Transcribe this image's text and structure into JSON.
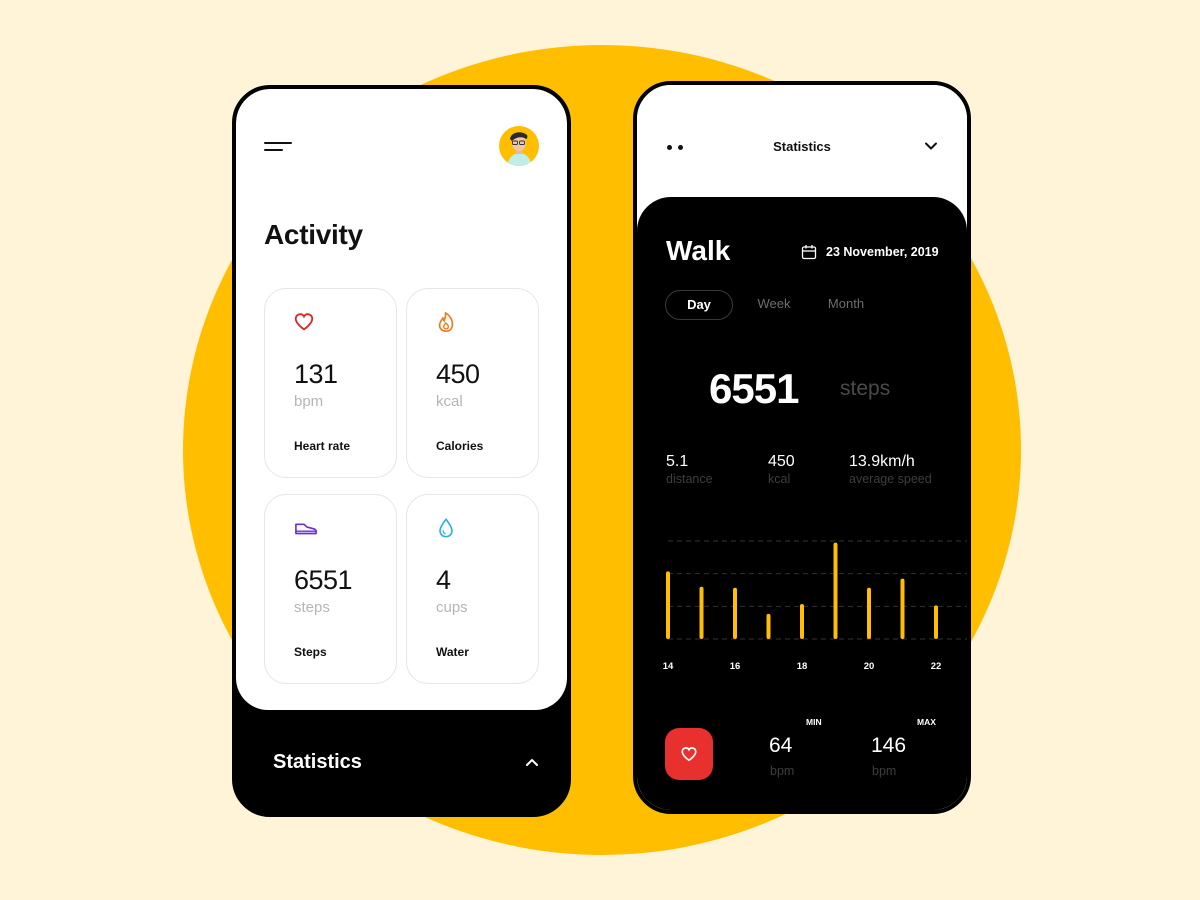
{
  "colors": {
    "background": "#fff4d8",
    "accent_yellow": "#ffbe00",
    "heart_red": "#e8302e",
    "calorie_orange": "#f07a1a",
    "steps_purple": "#6a2fd8",
    "water_blue": "#2ab0e0"
  },
  "activity_screen": {
    "menu_icon": "hamburger-menu-icon",
    "avatar": "user-avatar",
    "title": "Activity",
    "cards": [
      {
        "icon": "heart-icon",
        "value": "131",
        "unit": "bpm",
        "label": "Heart rate"
      },
      {
        "icon": "flame-icon",
        "value": "450",
        "unit": "kcal",
        "label": "Calories"
      },
      {
        "icon": "shoe-icon",
        "value": "6551",
        "unit": "steps",
        "label": "Steps"
      },
      {
        "icon": "water-drop-icon",
        "value": "4",
        "unit": "cups",
        "label": "Water"
      }
    ],
    "bottom_sheet": {
      "label": "Statistics",
      "icon": "chevron-up-icon"
    }
  },
  "statistics_screen": {
    "header": {
      "menu_icon": "dots-icon",
      "title": "Statistics",
      "collapse_icon": "chevron-down-icon"
    },
    "activity_title": "Walk",
    "date_icon": "calendar-icon",
    "date": "23 November, 2019",
    "tabs": [
      {
        "label": "Day",
        "active": true
      },
      {
        "label": "Week",
        "active": false
      },
      {
        "label": "Month",
        "active": false
      }
    ],
    "steps_value": "6551",
    "steps_unit": "steps",
    "metrics": [
      {
        "value": "5.1",
        "label": "distance"
      },
      {
        "value": "450",
        "label": "kcal"
      },
      {
        "value": "13.9km/h",
        "label": "average speed"
      }
    ],
    "heart_rate": {
      "icon": "heart-icon",
      "min_caption": "MIN",
      "min_value": "64",
      "min_unit": "bpm",
      "max_caption": "MAX",
      "max_value": "146",
      "max_unit": "bpm"
    }
  },
  "chart_data": {
    "type": "bar",
    "title": "",
    "xlabel": "",
    "ylabel": "",
    "x": [
      14,
      15,
      16,
      17,
      18,
      19,
      20,
      21,
      22
    ],
    "tick_labels": [
      "14",
      "16",
      "18",
      "20",
      "22"
    ],
    "tick_positions": [
      14,
      16,
      18,
      20,
      22
    ],
    "values": [
      2.07,
      1.6,
      1.57,
      0.77,
      1.07,
      2.95,
      1.57,
      1.85,
      1.03
    ],
    "ylim": [
      0,
      3
    ],
    "grid": true,
    "grid_values": [
      0,
      1,
      2,
      3
    ],
    "bar_color": "#ffbe00",
    "legend": "none"
  }
}
